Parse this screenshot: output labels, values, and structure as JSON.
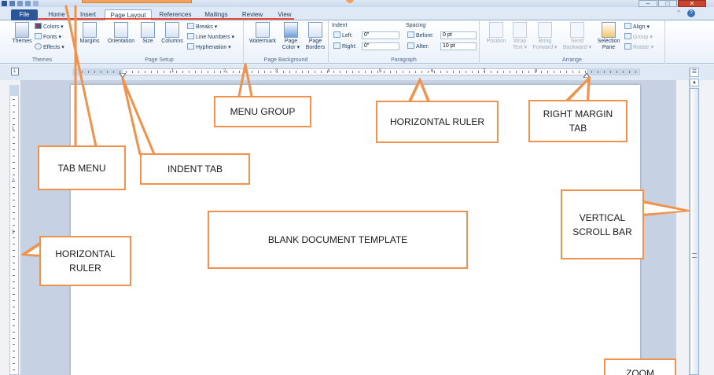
{
  "window": {
    "minimize_label": "–",
    "maximize_label": "□",
    "close_label": "✕"
  },
  "tabs": [
    {
      "label": "File"
    },
    {
      "label": "Home"
    },
    {
      "label": "Insert"
    },
    {
      "label": "Page Layout"
    },
    {
      "label": "References"
    },
    {
      "label": "Mailings"
    },
    {
      "label": "Review"
    },
    {
      "label": "View"
    }
  ],
  "help": {
    "minimize_ribbon": "^",
    "help": "?"
  },
  "ribbon": {
    "themes": {
      "themes_label": "Themes",
      "colors_label": "Colors ▾",
      "fonts_label": "Fonts ▾",
      "effects_label": "Effects ▾",
      "group_label": "Themes"
    },
    "page_setup": {
      "margins_label": "Margins",
      "orientation_label": "Orientation",
      "size_label": "Size",
      "columns_label": "Columns",
      "breaks_label": "Breaks ▾",
      "line_numbers_label": "Line Numbers ▾",
      "hyphenation_label": "Hyphenation ▾",
      "group_label": "Page Setup"
    },
    "page_background": {
      "watermark_label": "Watermark",
      "page_color_label": "Page Color ▾",
      "page_borders_label": "Page Borders",
      "group_label": "Page Background"
    },
    "paragraph": {
      "indent_label": "Indent",
      "left_label": "Left:",
      "left_value": "0\"",
      "right_label": "Right:",
      "right_value": "0\"",
      "spacing_label": "Spacing",
      "before_label": "Before:",
      "before_value": "0 pt",
      "after_label": "After:",
      "after_value": "10 pt",
      "group_label": "Paragraph"
    },
    "arrange": {
      "position_label": "Position",
      "wrap_text_label": "Wrap Text ▾",
      "bring_forward_label": "Bring Forward ▾",
      "send_backward_label": "Send Backward ▾",
      "selection_pane_label": "Selection Pane",
      "align_label": "Align ▾",
      "group_btn_label": "Group ▾",
      "rotate_label": "Rotate ▾",
      "group_label": "Arrange"
    }
  },
  "ruler": {
    "corner_label": "L",
    "numbers": [
      "1",
      "2",
      "3",
      "4",
      "5",
      "6",
      "7",
      "8"
    ],
    "vertical_numbers": [
      "1",
      "2",
      "3"
    ]
  },
  "callouts": {
    "menu_group": "MENU GROUP",
    "horizontal_ruler_top": "HORIZONTAL RULER",
    "right_margin_tab": "RIGHT MARGIN TAB",
    "tab_menu": "TAB MENU",
    "indent_tab": "INDENT TAB",
    "vertical_scroll_bar": "VERTICAL SCROLL BAR",
    "blank_document_template": "BLANK DOCUMENT TEMPLATE",
    "horizontal_ruler_left": "HORIZONTAL RULER",
    "zoom": "ZOOM"
  },
  "colors": {
    "callout_border": "#f0924b",
    "file_tab": "#2a5699",
    "tab_underline": "#e74c3c"
  }
}
